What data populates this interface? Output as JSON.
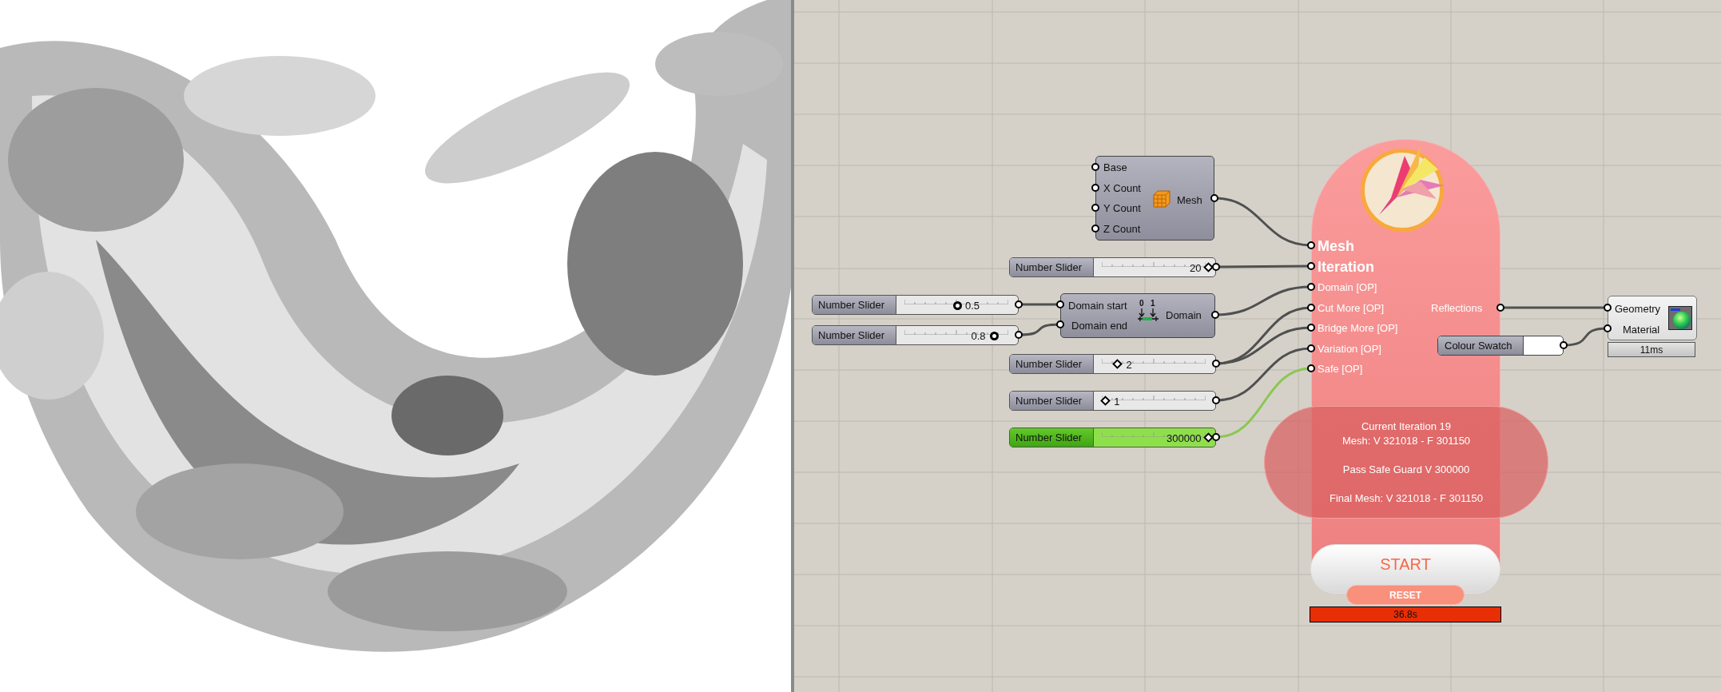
{
  "mesh_box": {
    "inputs": [
      "Base",
      "X Count",
      "Y Count",
      "Z Count"
    ],
    "output": "Mesh"
  },
  "sliders": [
    {
      "label": "Number Slider",
      "value": "20",
      "kind": "integer",
      "level": 0.95,
      "selected": false
    },
    {
      "label": "Number Slider",
      "value": "0.5",
      "kind": "float",
      "level": 0.5,
      "selected": false
    },
    {
      "label": "Number Slider",
      "value": "0.8",
      "kind": "float",
      "level": 0.8,
      "selected": false
    },
    {
      "label": "Number Slider",
      "value": "2",
      "kind": "integer",
      "level": 0.2,
      "selected": false
    },
    {
      "label": "Number Slider",
      "value": "1",
      "kind": "integer",
      "level": 0.1,
      "selected": false
    },
    {
      "label": "Number Slider",
      "value": "300000",
      "kind": "integer",
      "level": 0.95,
      "selected": true
    }
  ],
  "domain": {
    "inputs": [
      "Domain start",
      "Domain end"
    ],
    "icon_labels": [
      "0",
      "1"
    ],
    "output": "Domain"
  },
  "mesh_iteration": {
    "inputs": [
      {
        "label": "Mesh",
        "kind": "title"
      },
      {
        "label": "Iteration",
        "kind": "title"
      },
      {
        "label": "Domain [OP]",
        "kind": "option"
      },
      {
        "label": "Cut More [OP]",
        "kind": "option"
      },
      {
        "label": "Bridge More [OP]",
        "kind": "option"
      },
      {
        "label": "Variation [OP]",
        "kind": "option"
      },
      {
        "label": "Safe [OP]",
        "kind": "option"
      }
    ],
    "output": "Reflections",
    "info": [
      "Current Iteration 19",
      "Mesh: V 321018 - F 301150",
      "Pass Safe Guard V 300000",
      "Final Mesh: V 321018 - F 301150"
    ],
    "start": "START",
    "reset": "RESET",
    "time": "36.8s"
  },
  "colour_swatch": {
    "label": "Colour Swatch"
  },
  "render": {
    "inputs": [
      "Geometry",
      "Material"
    ],
    "time": "11ms"
  }
}
